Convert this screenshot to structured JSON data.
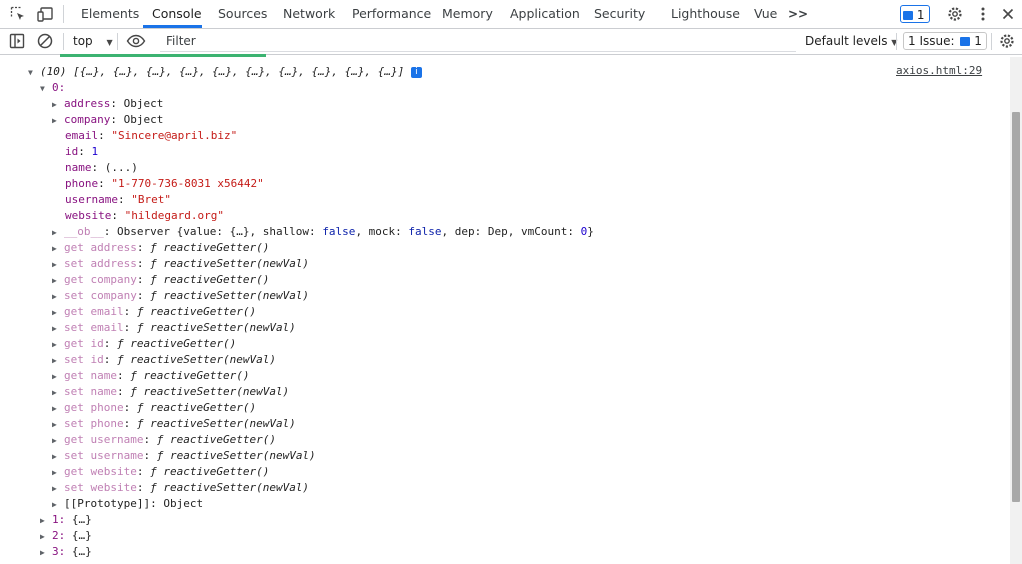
{
  "tabs": [
    {
      "label": "Elements"
    },
    {
      "label": "Console"
    },
    {
      "label": "Sources"
    },
    {
      "label": "Network"
    },
    {
      "label": "Performance"
    },
    {
      "label": "Memory"
    },
    {
      "label": "Application"
    },
    {
      "label": "Security"
    },
    {
      "label": "Lighthouse"
    },
    {
      "label": "Vue"
    }
  ],
  "active_tab": "Console",
  "more_tabs_glyph": ">>",
  "message_badge_count": "1",
  "toolbar": {
    "context": "top",
    "filter_placeholder": "Filter",
    "levels": "Default levels",
    "issues_label": "1 Issue:",
    "issues_count": "1"
  },
  "console": {
    "source_link": "axios.html:29",
    "array_summary": "(10) [{…}, {…}, {…}, {…}, {…}, {…}, {…}, {…}, {…}, {…}]",
    "info_glyph": "i",
    "item0_key": "0:",
    "props": [
      {
        "key": "address",
        "value": "Object",
        "type": "plain"
      },
      {
        "key": "company",
        "value": "Object",
        "type": "plain"
      },
      {
        "key": "email",
        "value": "\"Sincere@april.biz\"",
        "type": "str"
      },
      {
        "key": "id",
        "value": "1",
        "type": "num"
      },
      {
        "key": "name",
        "value": "(...)",
        "type": "plain"
      },
      {
        "key": "phone",
        "value": "\"1-770-736-8031 x56442\"",
        "type": "str"
      },
      {
        "key": "username",
        "value": "\"Bret\"",
        "type": "str"
      },
      {
        "key": "website",
        "value": "\"hildegard.org\"",
        "type": "str"
      }
    ],
    "ob": {
      "key": "__ob__",
      "p1": "Observer {value: {…}, shallow: ",
      "v1": "false",
      "p2": ", mock: ",
      "v2": "false",
      "p3": ", dep: Dep, vmCount: ",
      "v3": "0",
      "p4": "}"
    },
    "accessors": [
      {
        "key": "get address",
        "fn": "reactiveGetter()"
      },
      {
        "key": "set address",
        "fn": "reactiveSetter(newVal)"
      },
      {
        "key": "get company",
        "fn": "reactiveGetter()"
      },
      {
        "key": "set company",
        "fn": "reactiveSetter(newVal)"
      },
      {
        "key": "get email",
        "fn": "reactiveGetter()"
      },
      {
        "key": "set email",
        "fn": "reactiveSetter(newVal)"
      },
      {
        "key": "get id",
        "fn": "reactiveGetter()"
      },
      {
        "key": "set id",
        "fn": "reactiveSetter(newVal)"
      },
      {
        "key": "get name",
        "fn": "reactiveGetter()"
      },
      {
        "key": "set name",
        "fn": "reactiveSetter(newVal)"
      },
      {
        "key": "get phone",
        "fn": "reactiveGetter()"
      },
      {
        "key": "set phone",
        "fn": "reactiveSetter(newVal)"
      },
      {
        "key": "get username",
        "fn": "reactiveGetter()"
      },
      {
        "key": "set username",
        "fn": "reactiveSetter(newVal)"
      },
      {
        "key": "get website",
        "fn": "reactiveGetter()"
      },
      {
        "key": "set website",
        "fn": "reactiveSetter(newVal)"
      }
    ],
    "prototype": {
      "key": "[[Prototype]]",
      "value": "Object"
    },
    "items": [
      {
        "key": "1",
        "value": "{…}"
      },
      {
        "key": "2",
        "value": "{…}"
      },
      {
        "key": "3",
        "value": "{…}"
      }
    ]
  },
  "colors": {
    "accent": "#1a73e8",
    "key": "#881280",
    "string": "#c41a16",
    "number": "#1c00cf"
  }
}
